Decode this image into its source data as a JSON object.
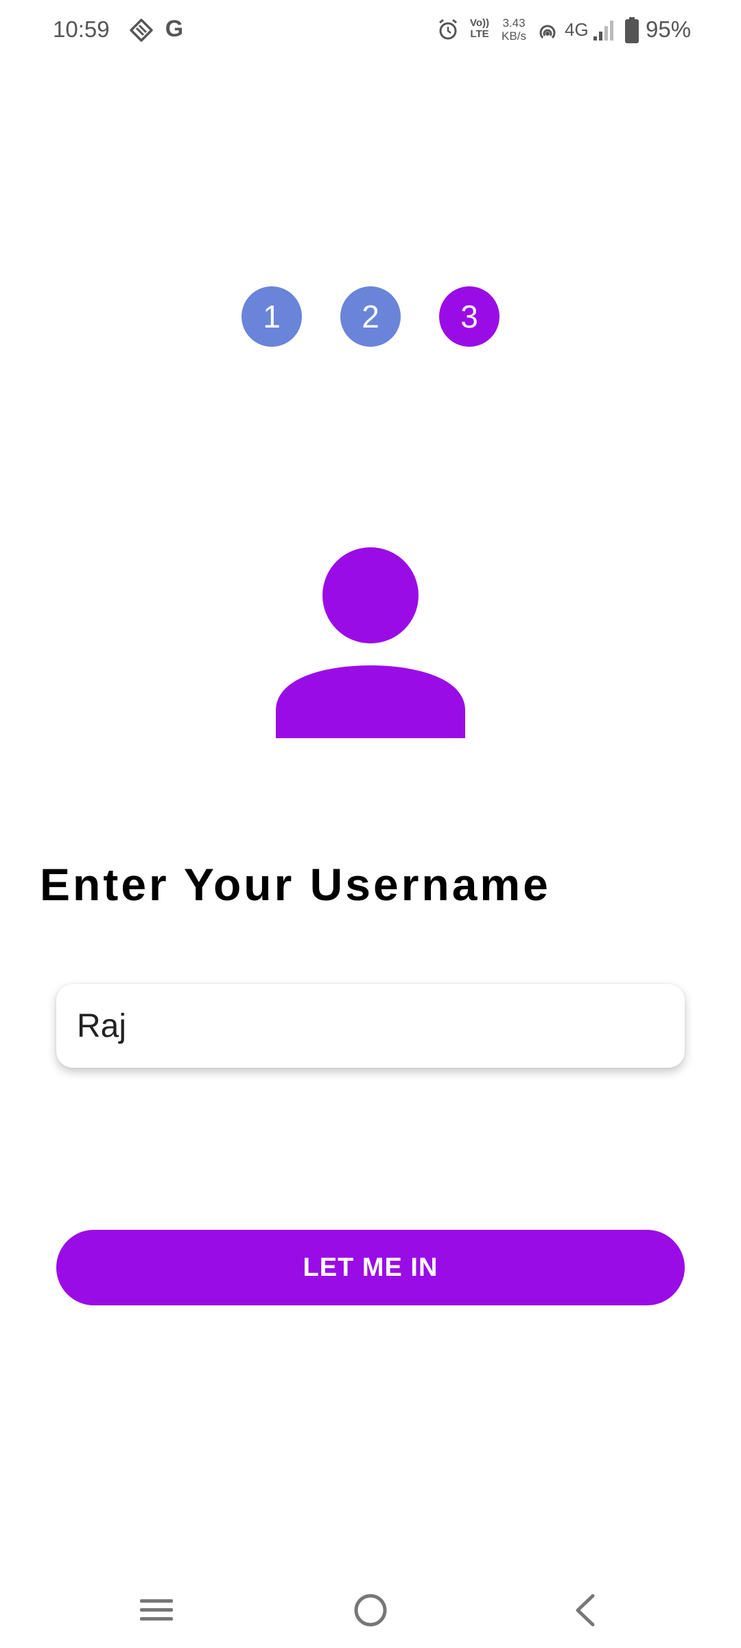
{
  "status_bar": {
    "time": "10:59",
    "icons": [
      "data-saver-icon",
      "google-icon",
      "alarm-icon",
      "volte-icon",
      "hotspot-icon",
      "signal-icon",
      "battery-icon"
    ],
    "g_letter": "G",
    "volte_line1": "Vo))",
    "volte_line2": "LTE",
    "speed_value": "3.43",
    "speed_unit": "KB/s",
    "network": "4G",
    "battery_percent": "95%"
  },
  "steps": [
    {
      "label": "1",
      "color": "#6a84d9"
    },
    {
      "label": "2",
      "color": "#6a84d9"
    },
    {
      "label": "3",
      "color": "#9a0ce6"
    }
  ],
  "avatar": {
    "icon": "person-icon",
    "color": "#9a0ce6"
  },
  "title": "Enter Your Username",
  "username_field": {
    "value": "Raj"
  },
  "submit_button": {
    "label": "LET ME IN",
    "color": "#9a0ce6"
  },
  "nav_bar": {
    "icons": [
      "menu-icon",
      "home-icon",
      "back-icon"
    ],
    "color": "#777777"
  }
}
